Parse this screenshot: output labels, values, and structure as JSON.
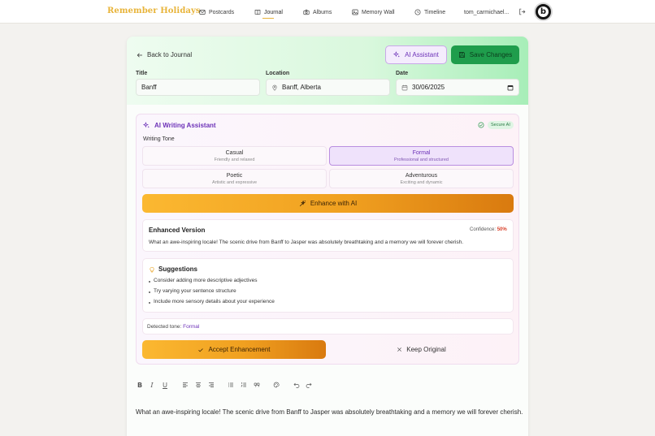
{
  "nav": {
    "brand": "Remember Holidays",
    "items": [
      {
        "label": "Postcards",
        "icon": "mail-icon"
      },
      {
        "label": "Journal",
        "icon": "book-icon",
        "active": true
      },
      {
        "label": "Albums",
        "icon": "camera-icon"
      },
      {
        "label": "Memory Wall",
        "icon": "image-icon"
      },
      {
        "label": "Timeline",
        "icon": "clock-icon"
      }
    ],
    "username": "tom_carmichael...",
    "avatar_letter": "b"
  },
  "header": {
    "back_label": "Back to Journal",
    "ai_button_label": "AI Assistant",
    "save_button_label": "Save Changes",
    "fields": {
      "title_label": "Title",
      "title_value": "Banff",
      "location_label": "Location",
      "location_value": "Banff, Alberta",
      "date_label": "Date",
      "date_value": "30/06/2025"
    }
  },
  "assistant": {
    "title": "AI Writing Assistant",
    "secure_badge": "Secure AI",
    "tone_label": "Writing Tone",
    "tones": [
      {
        "name": "Casual",
        "desc": "Friendly and relaxed",
        "selected": false
      },
      {
        "name": "Formal",
        "desc": "Professional and structured",
        "selected": true
      },
      {
        "name": "Poetic",
        "desc": "Artistic and expressive",
        "selected": false
      },
      {
        "name": "Adventurous",
        "desc": "Exciting and dynamic",
        "selected": false
      }
    ],
    "enhance_label": "Enhance with AI",
    "enhanced": {
      "title": "Enhanced Version",
      "confidence_label": "Confidence:",
      "confidence_value": "50%",
      "text": "What an awe-inspiring locale! The scenic drive from Banff to Jasper was absolutely breathtaking and a memory we will forever cherish."
    },
    "suggestions": {
      "title": "Suggestions",
      "items": [
        "Consider adding more descriptive adjectives",
        "Try varying your sentence structure",
        "Include more sensory details about your experience"
      ]
    },
    "detected_label": "Detected tone:",
    "detected_value": "Formal",
    "accept_label": "Accept Enhancement",
    "keep_label": "Keep Original"
  },
  "editor": {
    "toolbar": [
      "bold-icon",
      "italic-icon",
      "underline-icon",
      "align-left-icon",
      "align-center-icon",
      "align-right-icon",
      "bullet-list-icon",
      "numbered-list-icon",
      "quote-icon",
      "palette-icon",
      "undo-icon",
      "redo-icon"
    ],
    "text": "What an awe-inspiring locale! The scenic drive from Banff to Jasper was absolutely breathtaking and a memory we will forever cherish."
  },
  "colors": {
    "brand": "#e8b43a",
    "accent_purple": "#6d32b8",
    "save_green": "#1f9d4c",
    "enhance_orange": "#f0a020",
    "confidence_red": "#d9412b"
  }
}
